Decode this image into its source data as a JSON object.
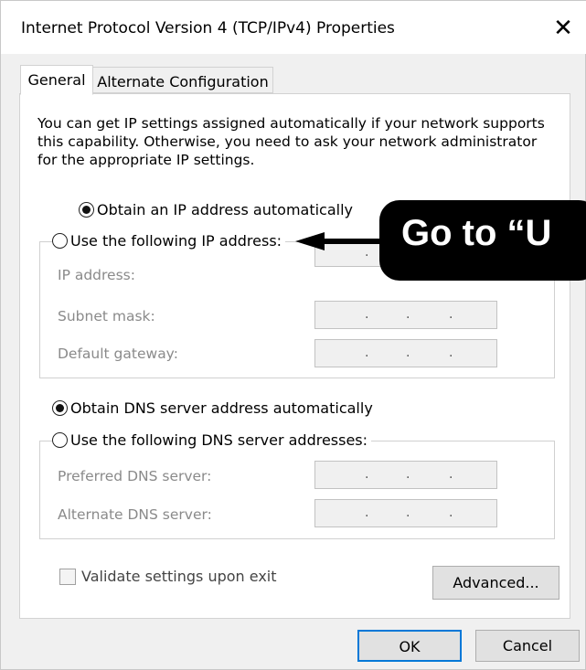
{
  "window": {
    "title": "Internet Protocol Version 4 (TCP/IPv4) Properties",
    "close_glyph": "✕"
  },
  "tabs": [
    {
      "label": "General",
      "active": true
    },
    {
      "label": "Alternate Configuration",
      "active": false
    }
  ],
  "intro": "You can get IP settings assigned automatically if your network supports this capability. Otherwise, you need to ask your network administrator for the appropriate IP settings.",
  "ip_section": {
    "auto_label": "Obtain an IP address automatically",
    "manual_label": "Use the following IP address:",
    "selected": "auto",
    "fields": [
      {
        "label": "IP address:",
        "value": ""
      },
      {
        "label": "Subnet mask:",
        "value": ""
      },
      {
        "label": "Default gateway:",
        "value": ""
      }
    ]
  },
  "dns_section": {
    "auto_label": "Obtain DNS server address automatically",
    "manual_label": "Use the following DNS server addresses:",
    "selected": "auto",
    "fields": [
      {
        "label": "Preferred DNS server:",
        "value": ""
      },
      {
        "label": "Alternate DNS server:",
        "value": ""
      }
    ]
  },
  "validate_label": "Validate settings upon exit",
  "buttons": {
    "advanced": "Advanced...",
    "ok": "OK",
    "cancel": "Cancel"
  },
  "callout": {
    "text": "Go to “U"
  },
  "colors": {
    "accent": "#0078d7",
    "callout_bg": "#000000",
    "disabled_text": "#8a8a8a"
  }
}
